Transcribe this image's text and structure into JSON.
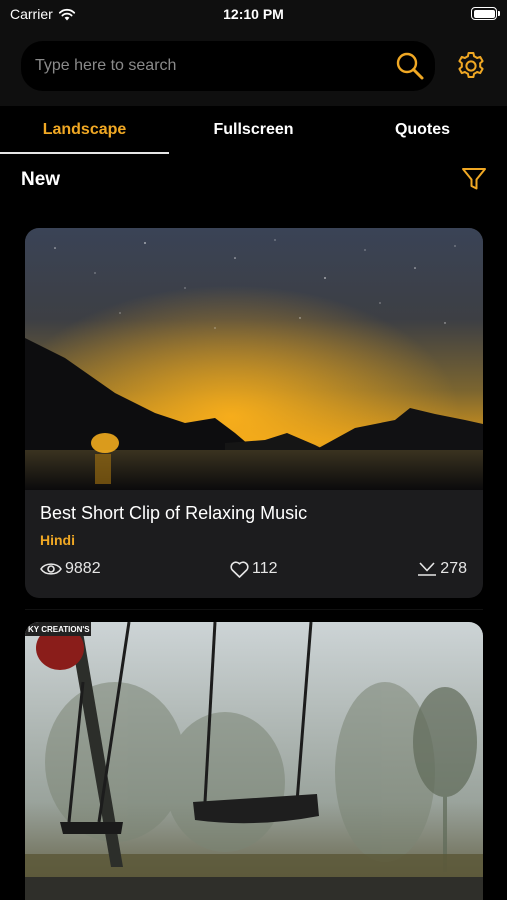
{
  "status_bar": {
    "carrier": "Carrier",
    "time": "12:10 PM"
  },
  "search": {
    "placeholder": "Type here to search"
  },
  "tabs": [
    {
      "label": "Landscape",
      "active": true
    },
    {
      "label": "Fullscreen",
      "active": false
    },
    {
      "label": "Quotes",
      "active": false
    }
  ],
  "section": {
    "title": "New"
  },
  "cards": [
    {
      "title": "Best Short Clip of Relaxing Music",
      "language": "Hindi",
      "views": "9882",
      "likes": "112",
      "downloads": "278"
    },
    {
      "watermark": "KY CREATION'S"
    }
  ],
  "colors": {
    "accent": "#f0a824",
    "background": "#000000",
    "card": "#1c1c1e",
    "header": "#0f0f0f"
  },
  "icons": {
    "search": "search-icon",
    "settings": "gear-icon",
    "filter": "filter-icon",
    "views": "eye-icon",
    "likes": "heart-icon",
    "downloads": "download-icon"
  }
}
